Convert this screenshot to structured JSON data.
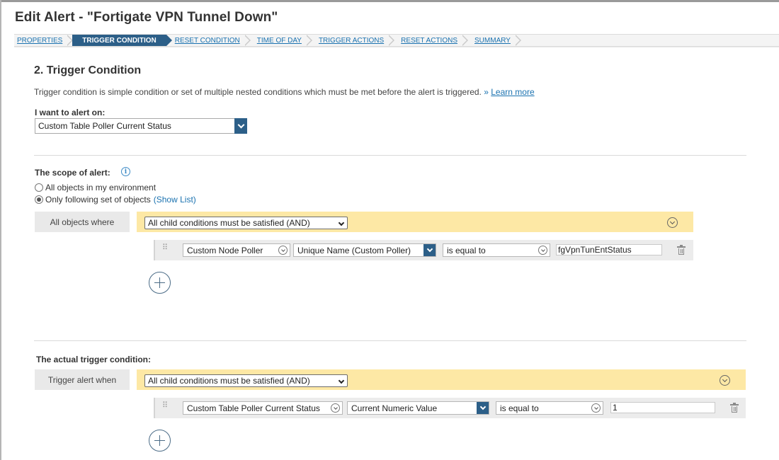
{
  "page": {
    "title": "Edit Alert - \"Fortigate VPN Tunnel Down\""
  },
  "wizard": {
    "steps": [
      {
        "label": "PROPERTIES",
        "active": false
      },
      {
        "label": "TRIGGER CONDITION",
        "active": true
      },
      {
        "label": "RESET CONDITION",
        "active": false
      },
      {
        "label": "TIME OF DAY",
        "active": false
      },
      {
        "label": "TRIGGER ACTIONS",
        "active": false
      },
      {
        "label": "RESET ACTIONS",
        "active": false
      },
      {
        "label": "SUMMARY",
        "active": false
      }
    ]
  },
  "section": {
    "heading": "2. Trigger Condition",
    "description": "Trigger condition is simple condition or set of multiple nested conditions which must be met before the alert is triggered.",
    "learn_more_prefix": "»",
    "learn_more": "Learn more"
  },
  "alert_on": {
    "label": "I want to alert on:",
    "value": "Custom Table Poller Current Status"
  },
  "scope": {
    "label": "The scope of alert:",
    "info_icon": "info-icon",
    "option_all": "All objects in my environment",
    "option_following": "Only following set of objects",
    "show_list": "(Show List)",
    "selected": "following",
    "group_label": "All objects where",
    "group_logic": "All child conditions must be satisfied (AND)",
    "condition": {
      "entity": "Custom Node Poller",
      "property": "Unique Name (Custom Poller)",
      "operator": "is equal to",
      "value": "fgVpnTunEntStatus"
    }
  },
  "trigger": {
    "label": "The actual trigger condition:",
    "group_label": "Trigger alert when",
    "group_logic": "All child conditions must be satisfied (AND)",
    "condition": {
      "entity": "Custom Table Poller Current Status",
      "property": "Current Numeric Value",
      "operator": "is equal to",
      "value": "1"
    }
  },
  "colors": {
    "accent": "#2c5f88",
    "link": "#1a72b0",
    "group_bar": "#fde8a5",
    "group_label_bg": "#e9e9e9"
  }
}
